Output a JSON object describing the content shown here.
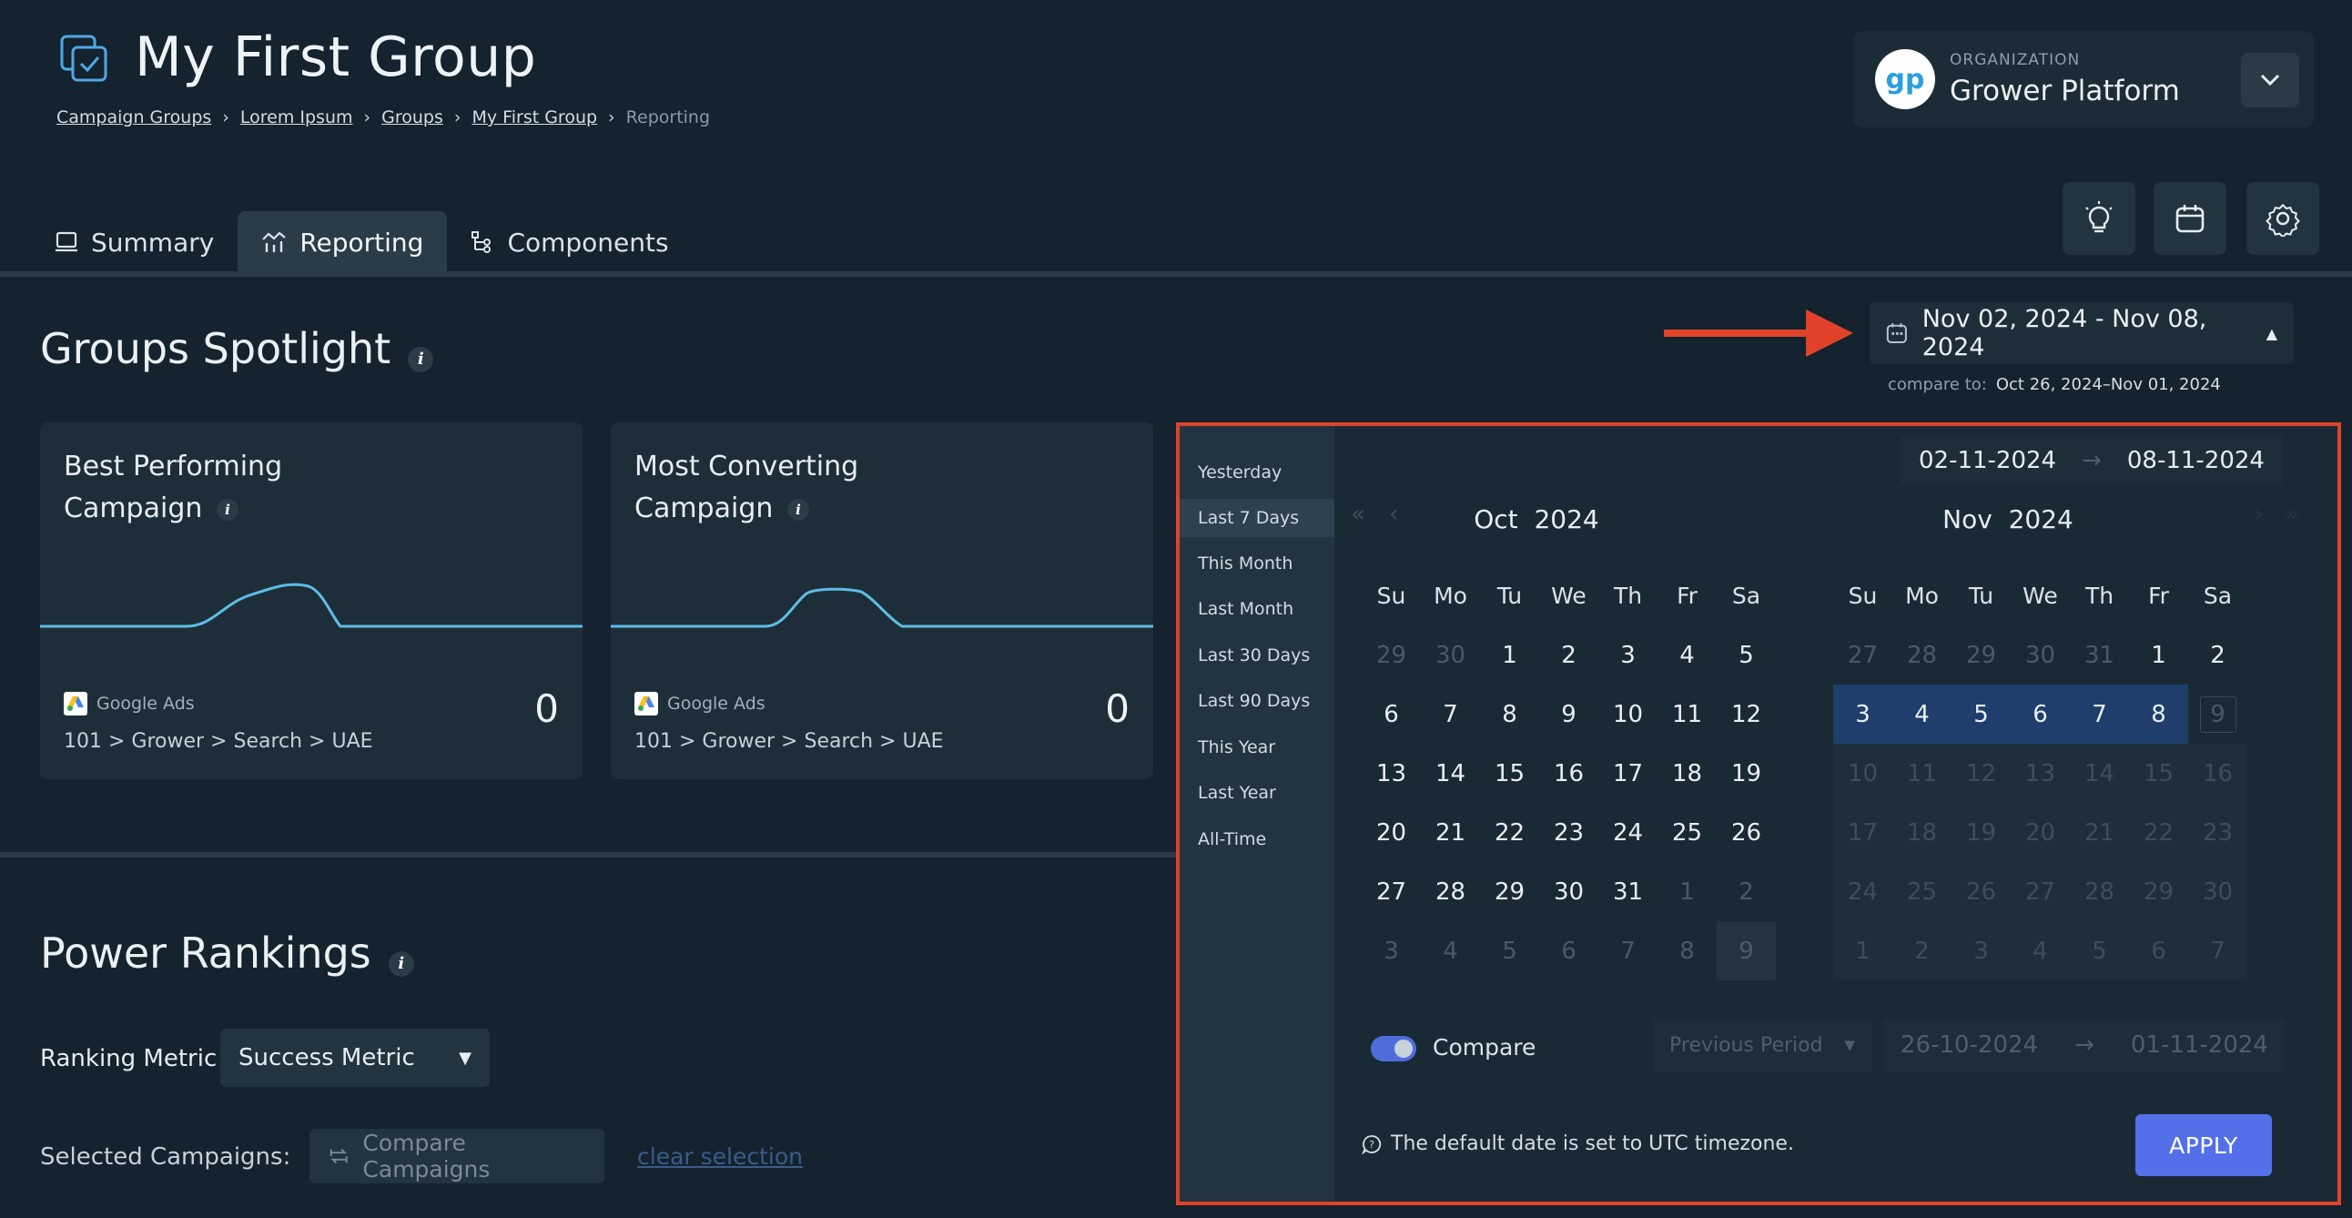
{
  "header": {
    "title": "My First Group",
    "breadcrumb": [
      "Campaign Groups",
      "Lorem Ipsum",
      "Groups",
      "My First Group"
    ],
    "breadcrumb_current": "Reporting",
    "separator": "›"
  },
  "organization": {
    "label": "ORGANIZATION",
    "name": "Grower Platform",
    "logo_text": "gp"
  },
  "tabs": [
    {
      "label": "Summary",
      "icon": "monitor-icon"
    },
    {
      "label": "Reporting",
      "icon": "chart-icon",
      "active": true
    },
    {
      "label": "Components",
      "icon": "tree-icon"
    }
  ],
  "toolbar_icons": [
    "lightbulb-icon",
    "calendar-icon",
    "gear-icon"
  ],
  "spotlight": {
    "title": "Groups Spotlight",
    "cards": [
      {
        "title_line1": "Best Performing",
        "title_line2": "Campaign",
        "source": "Google Ads",
        "path": "101 > Grower > Search > UAE",
        "value": "0"
      },
      {
        "title_line1": "Most Converting",
        "title_line2": "Campaign",
        "source": "Google Ads",
        "path": "101 > Grower > Search > UAE",
        "value": "0"
      }
    ]
  },
  "date_range": {
    "display": "Nov 02, 2024 - Nov 08, 2024",
    "compare_label": "compare to:",
    "compare_value": "Oct 26, 2024–Nov 01, 2024"
  },
  "picker": {
    "presets": [
      "Yesterday",
      "Last 7 Days",
      "This Month",
      "Last Month",
      "Last 30 Days",
      "Last 90 Days",
      "This Year",
      "Last Year",
      "All-Time"
    ],
    "active_preset": "Last 7 Days",
    "start": "02-11-2024",
    "end": "08-11-2024",
    "range_arrow": "→",
    "weekdays": [
      "Su",
      "Mo",
      "Tu",
      "We",
      "Th",
      "Fr",
      "Sa"
    ],
    "left_month": "Oct",
    "left_year": "2024",
    "right_month": "Nov",
    "right_year": "2024",
    "compare_label": "Compare",
    "compare_enabled": true,
    "period_option": "Previous Period",
    "prev_start": "26-10-2024",
    "prev_end": "01-11-2024",
    "timezone_note": "The default date is set to UTC timezone.",
    "apply_label": "APPLY"
  },
  "power_rankings": {
    "title": "Power Rankings",
    "metric_label": "Ranking Metric",
    "metric_value": "Success Metric",
    "selected_label": "Selected Campaigns:",
    "compare_button": "Compare Campaigns",
    "clear_link": "clear selection"
  }
}
